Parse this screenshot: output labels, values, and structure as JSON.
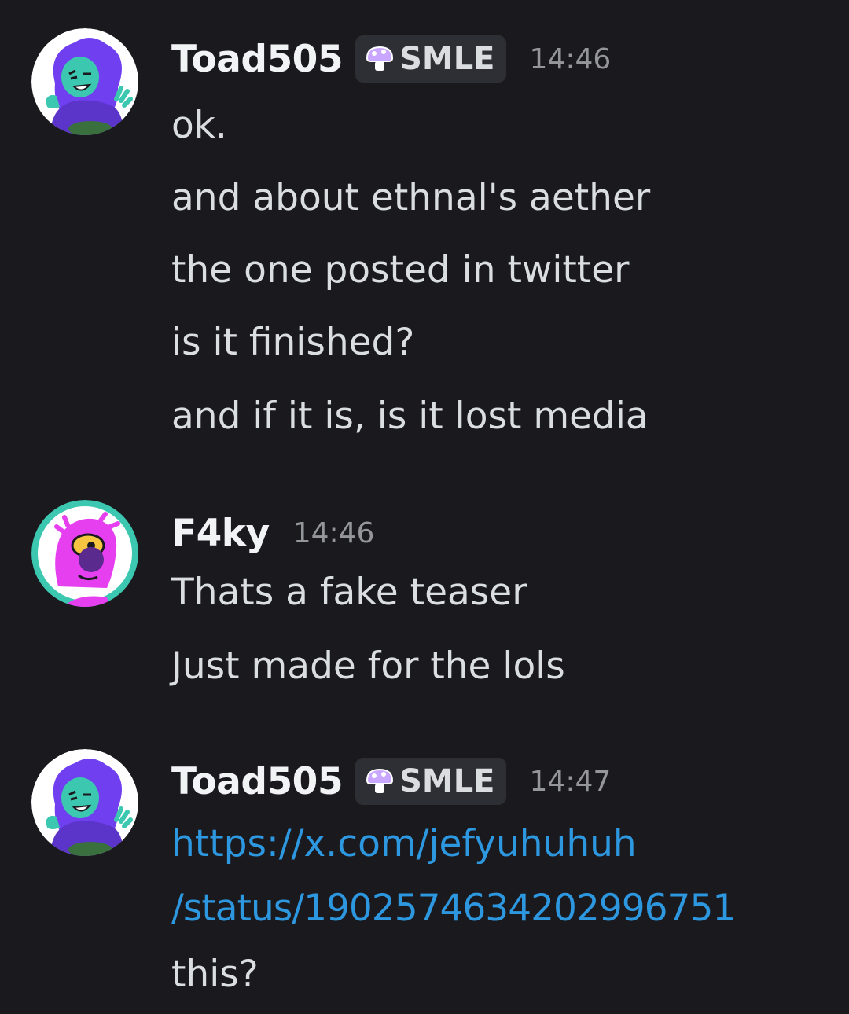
{
  "messages": [
    {
      "author": "Toad505",
      "tag": "SMLE",
      "time": "14:46",
      "avatar_icon": "purple-haired-character-avatar",
      "lines": [
        "ok.",
        "and about ethnal's aether",
        "the one posted in twitter",
        "is it finished?",
        "and if it is, is it lost media"
      ]
    },
    {
      "author": "F4ky",
      "time": "14:46",
      "avatar_icon": "pink-character-avatar",
      "lines": [
        "Thats a fake teaser",
        "Just made for the lols"
      ]
    },
    {
      "author": "Toad505",
      "tag": "SMLE",
      "time": "14:47",
      "avatar_icon": "purple-haired-character-avatar",
      "link_lines": [
        "https://x.com/jefyuhuhuh",
        "/status/1902574634202996751"
      ],
      "lines": [
        "this?"
      ]
    }
  ],
  "colors": {
    "background": "#1a1a1e",
    "text": "#dbdee1",
    "username": "#f2f3f5",
    "timestamp": "#94969c",
    "link": "#2d97e0",
    "tag_background": "#2e2f35"
  }
}
